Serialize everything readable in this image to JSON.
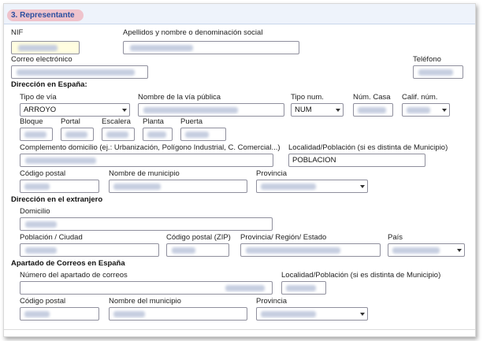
{
  "section": {
    "title": "3. Representante"
  },
  "labels": {
    "nif": "NIF",
    "apellidos": "Apellidos y nombre o denominación social",
    "correo": "Correo electrónico",
    "telefono": "Teléfono"
  },
  "direccion_espana": {
    "heading": "Dirección en España:",
    "tipo_via": {
      "label": "Tipo de vía",
      "value": "ARROYO"
    },
    "nombre_via": {
      "label": "Nombre de la vía pública"
    },
    "tipo_num": {
      "label": "Tipo num.",
      "value": "NUM"
    },
    "num_casa": {
      "label": "Núm. Casa"
    },
    "calif_num": {
      "label": "Calif. núm."
    },
    "bloque": {
      "label": "Bloque"
    },
    "portal": {
      "label": "Portal"
    },
    "escalera": {
      "label": "Escalera"
    },
    "planta": {
      "label": "Planta"
    },
    "puerta": {
      "label": "Puerta"
    },
    "complemento": {
      "label": "Complemento domicilio (ej.: Urbanización, Polígono Industrial, C. Comercial...)"
    },
    "localidad": {
      "label": "Localidad/Población (si es distinta de Municipio)",
      "value": "POBLACION"
    },
    "codigo_postal": {
      "label": "Código postal"
    },
    "municipio": {
      "label": "Nombre de municipio"
    },
    "provincia": {
      "label": "Provincia"
    }
  },
  "direccion_extranjero": {
    "heading": "Dirección en el extranjero",
    "domicilio": {
      "label": "Domicilio"
    },
    "poblacion": {
      "label": "Población / Ciudad"
    },
    "codigo_zip": {
      "label": "Código postal (ZIP)"
    },
    "region": {
      "label": "Provincia/ Región/ Estado"
    },
    "pais": {
      "label": "País"
    }
  },
  "apartado_correos": {
    "heading": "Apartado de Correos en España",
    "numero": {
      "label": "Número del apartado de correos"
    },
    "localidad": {
      "label": "Localidad/Población (si es distinta de Municipio)"
    },
    "codigo_postal": {
      "label": "Código postal"
    },
    "municipio": {
      "label": "Nombre del municipio"
    },
    "provincia": {
      "label": "Provincia"
    }
  }
}
